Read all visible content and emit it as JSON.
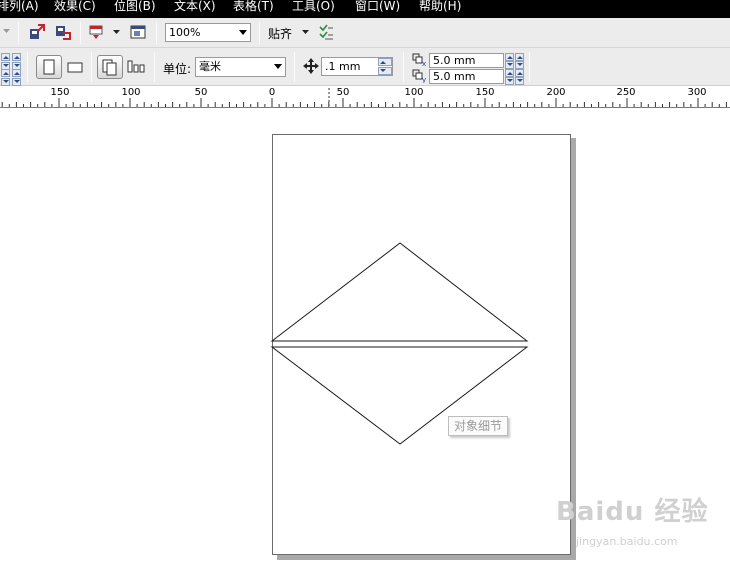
{
  "menu": {
    "items": [
      {
        "label": "排列(A)"
      },
      {
        "label": "效果(C)"
      },
      {
        "label": "位图(B)"
      },
      {
        "label": "文本(X)"
      },
      {
        "label": "表格(T)"
      },
      {
        "label": "工具(O)"
      },
      {
        "label": "窗口(W)"
      },
      {
        "label": "帮助(H)"
      }
    ]
  },
  "toolbar": {
    "zoom_value": "100%",
    "snap_label": "贴齐",
    "icons": [
      "import-icon",
      "export-icon",
      "publish-pdf-icon",
      "application-launcher-icon",
      "snap-options-icon"
    ]
  },
  "property_bar": {
    "units_label": "单位:",
    "units_value": "毫米",
    "nudge_value": ".1 mm",
    "dup_x_value": "5.0 mm",
    "dup_y_value": "5.0 mm",
    "orientation": "portrait"
  },
  "ruler": {
    "ticks": [
      "150",
      "100",
      "50",
      "0",
      "50",
      "100",
      "150",
      "200",
      "250",
      "300"
    ]
  },
  "canvas": {
    "tooltip_text": "对象细节"
  },
  "watermark": {
    "brand_text": "Baidu 经验",
    "url_text": "jingyan.baidu.com"
  }
}
